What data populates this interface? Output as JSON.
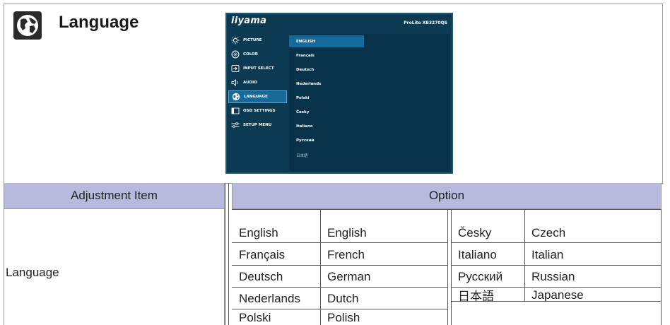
{
  "section": {
    "title": "Language",
    "icon": "globe-icon"
  },
  "osd": {
    "brand": "iiyama",
    "model": "ProLite XB3270QS",
    "menu": [
      {
        "label": "PICTURE",
        "icon": "brightness-icon"
      },
      {
        "label": "COLOR",
        "icon": "color-icon"
      },
      {
        "label": "INPUT SELECT",
        "icon": "input-icon"
      },
      {
        "label": "AUDIO",
        "icon": "speaker-icon"
      },
      {
        "label": "LANGUAGE",
        "icon": "globe-icon"
      },
      {
        "label": "OSD SETTINGS",
        "icon": "osd-icon"
      },
      {
        "label": "SETUP MENU",
        "icon": "sliders-icon"
      }
    ],
    "selected_menu": "LANGUAGE",
    "languages": [
      "ENGLISH",
      "Français",
      "Deutsch",
      "Nederlands",
      "Polski",
      "Česky",
      "Italiano",
      "Русский",
      "日本語"
    ],
    "selected_language": "ENGLISH"
  },
  "table": {
    "header_item": "Adjustment Item",
    "header_option": "Option",
    "item": "Language",
    "left_pairs": [
      [
        "English",
        "English"
      ],
      [
        "Français",
        "French"
      ],
      [
        "Deutsch",
        "German"
      ],
      [
        "Nederlands",
        "Dutch"
      ],
      [
        "Polski",
        "Polish"
      ]
    ],
    "right_pairs": [
      [
        "Česky",
        "Czech"
      ],
      [
        "Italiano",
        "Italian"
      ],
      [
        "Русский",
        "Russian"
      ],
      [
        "日本語",
        "Japanese"
      ]
    ]
  },
  "colors": {
    "header_bg": "#b9b9dd",
    "osd_bg": "#0b3a52",
    "osd_highlight": "#17699a"
  }
}
